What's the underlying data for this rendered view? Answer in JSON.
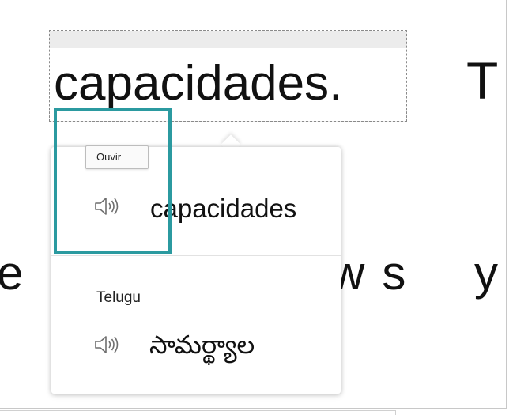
{
  "document": {
    "selected_word": "capacidades.",
    "next_letter": "T",
    "second_line_partial": "e ",
    "second_line_mid": "ws",
    "second_line_right": "y"
  },
  "popup": {
    "tooltip": "Ouvir",
    "source_word": "capacidades",
    "target_language": "Telugu",
    "translated_word": "సామర్థ్యాల"
  },
  "icons": {
    "speaker_source": "speaker-icon",
    "speaker_translation": "speaker-icon"
  },
  "colors": {
    "highlight": "#2b9aa0",
    "speaker": "#6e6e6e"
  }
}
